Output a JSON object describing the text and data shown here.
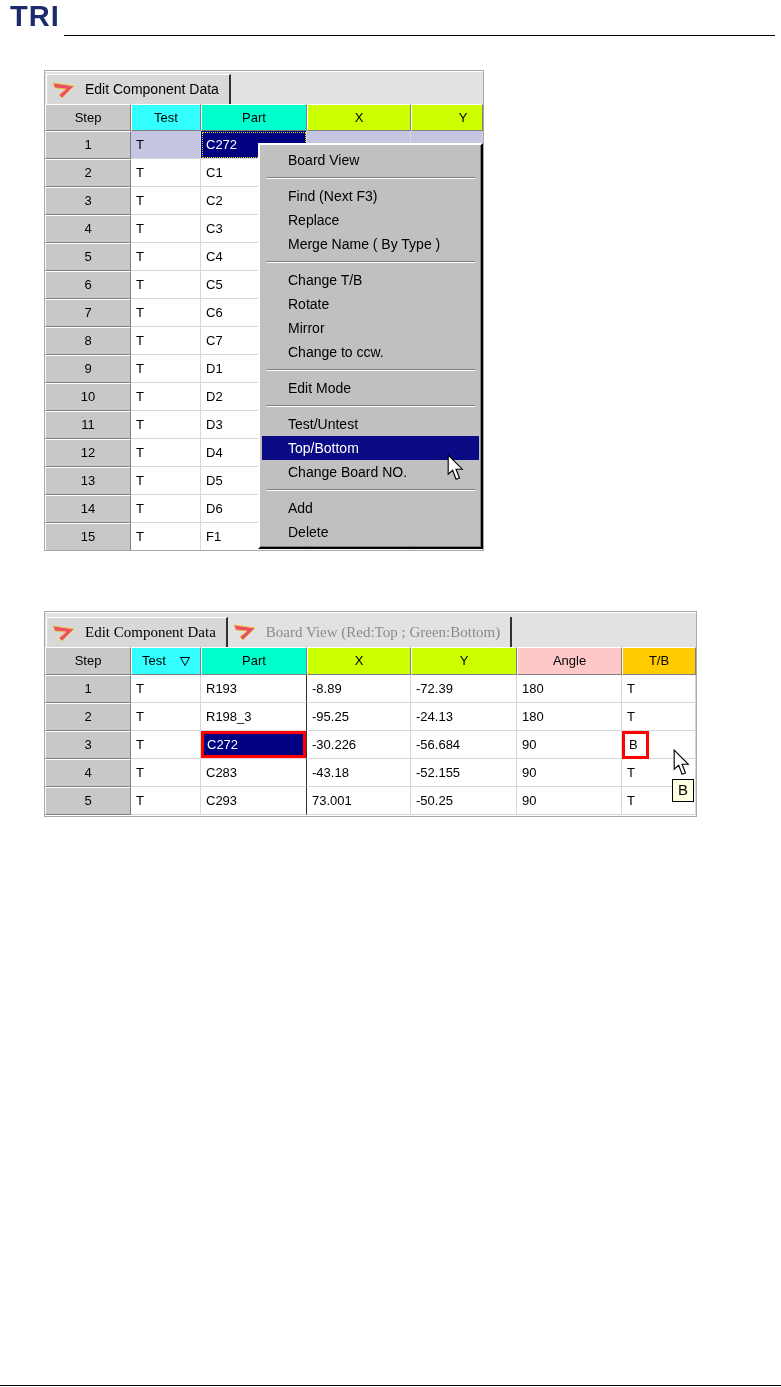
{
  "header": {
    "logo": "TRI"
  },
  "screenshots": [
    {
      "tabs": [
        {
          "label": "Edit Component Data",
          "selected": true
        }
      ],
      "table": {
        "columns": [
          {
            "label": "Step",
            "color": "#c8c8c8",
            "filtered": false
          },
          {
            "label": "Test",
            "color": "#33ffff",
            "filtered": false
          },
          {
            "label": "Part",
            "color": "#00ffcc",
            "filtered": false
          },
          {
            "label": "X",
            "color": "#ccff00",
            "filtered": false
          },
          {
            "label": "Y",
            "color": "#ccff00",
            "filtered": false
          }
        ],
        "rows": [
          {
            "step": "1",
            "selected": true,
            "cells": [
              {
                "text": "T",
                "selected": false,
                "highlighted": false
              },
              {
                "text": "C272",
                "selected": true,
                "highlighted": false
              }
            ]
          },
          {
            "step": "2",
            "selected": false,
            "cells": [
              {
                "text": "T",
                "selected": false,
                "highlighted": false
              },
              {
                "text": "C1",
                "selected": false,
                "highlighted": false
              }
            ]
          },
          {
            "step": "3",
            "selected": false,
            "cells": [
              {
                "text": "T",
                "selected": false,
                "highlighted": false
              },
              {
                "text": "C2",
                "selected": false,
                "highlighted": false
              }
            ]
          },
          {
            "step": "4",
            "selected": false,
            "cells": [
              {
                "text": "T",
                "selected": false,
                "highlighted": false
              },
              {
                "text": "C3",
                "selected": false,
                "highlighted": false
              }
            ]
          },
          {
            "step": "5",
            "selected": false,
            "cells": [
              {
                "text": "T",
                "selected": false,
                "highlighted": false
              },
              {
                "text": "C4",
                "selected": false,
                "highlighted": false
              }
            ]
          },
          {
            "step": "6",
            "selected": false,
            "cells": [
              {
                "text": "T",
                "selected": false,
                "highlighted": false
              },
              {
                "text": "C5",
                "selected": false,
                "highlighted": false
              }
            ]
          },
          {
            "step": "7",
            "selected": false,
            "cells": [
              {
                "text": "T",
                "selected": false,
                "highlighted": false
              },
              {
                "text": "C6",
                "selected": false,
                "highlighted": false
              }
            ]
          },
          {
            "step": "8",
            "selected": false,
            "cells": [
              {
                "text": "T",
                "selected": false,
                "highlighted": false
              },
              {
                "text": "C7",
                "selected": false,
                "highlighted": false
              }
            ]
          },
          {
            "step": "9",
            "selected": false,
            "cells": [
              {
                "text": "T",
                "selected": false,
                "highlighted": false
              },
              {
                "text": "D1",
                "selected": false,
                "highlighted": false
              }
            ]
          },
          {
            "step": "10",
            "selected": false,
            "cells": [
              {
                "text": "T",
                "selected": false,
                "highlighted": false
              },
              {
                "text": "D2",
                "selected": false,
                "highlighted": false
              }
            ]
          },
          {
            "step": "11",
            "selected": false,
            "cells": [
              {
                "text": "T",
                "selected": false,
                "highlighted": false
              },
              {
                "text": "D3",
                "selected": false,
                "highlighted": false
              }
            ]
          },
          {
            "step": "12",
            "selected": false,
            "cells": [
              {
                "text": "T",
                "selected": false,
                "highlighted": false
              },
              {
                "text": "D4",
                "selected": false,
                "highlighted": false
              }
            ]
          },
          {
            "step": "13",
            "selected": false,
            "cells": [
              {
                "text": "T",
                "selected": false,
                "highlighted": false
              },
              {
                "text": "D5",
                "selected": false,
                "highlighted": false
              }
            ]
          },
          {
            "step": "14",
            "selected": false,
            "cells": [
              {
                "text": "T",
                "selected": false,
                "highlighted": false
              },
              {
                "text": "D6",
                "selected": false,
                "highlighted": false
              }
            ]
          },
          {
            "step": "15",
            "selected": false,
            "cells": [
              {
                "text": "T",
                "selected": false,
                "highlighted": false
              },
              {
                "text": "F1",
                "selected": false,
                "highlighted": false
              }
            ]
          }
        ]
      },
      "context_menu": {
        "items": [
          {
            "kind": "item",
            "label": "Board View",
            "selected": false
          },
          {
            "kind": "separator"
          },
          {
            "kind": "item",
            "label": "Find (Next F3)",
            "selected": false
          },
          {
            "kind": "item",
            "label": "Replace",
            "selected": false
          },
          {
            "kind": "item",
            "label": "Merge Name ( By Type )",
            "selected": false
          },
          {
            "kind": "separator"
          },
          {
            "kind": "item",
            "label": "Change T/B",
            "selected": false
          },
          {
            "kind": "item",
            "label": "Rotate",
            "selected": false
          },
          {
            "kind": "item",
            "label": "Mirror",
            "selected": false
          },
          {
            "kind": "item",
            "label": "Change to ccw.",
            "selected": false
          },
          {
            "kind": "separator"
          },
          {
            "kind": "item",
            "label": "Edit Mode",
            "selected": false
          },
          {
            "kind": "separator"
          },
          {
            "kind": "item",
            "label": "Test/Untest",
            "selected": false
          },
          {
            "kind": "item",
            "label": "Top/Bottom",
            "selected": true
          },
          {
            "kind": "item",
            "label": "Change Board NO.",
            "selected": false
          },
          {
            "kind": "separator"
          },
          {
            "kind": "item",
            "label": "Add",
            "selected": false
          },
          {
            "kind": "item",
            "label": "Delete",
            "selected": false
          }
        ]
      }
    },
    {
      "tabs": [
        {
          "label": "Edit Component Data",
          "selected": true
        },
        {
          "label": "Board View (Red:Top ; Green:Bottom)",
          "selected": false
        }
      ],
      "table": {
        "columns": [
          {
            "label": "Step",
            "color": "#c8c8c8",
            "filtered": false
          },
          {
            "label": "Test",
            "color": "#33ffff",
            "filtered": true
          },
          {
            "label": "Part",
            "color": "#00ffcc",
            "filtered": false
          },
          {
            "label": "X",
            "color": "#ccff00",
            "filtered": false
          },
          {
            "label": "Y",
            "color": "#ccff00",
            "filtered": false
          },
          {
            "label": "Angle",
            "color": "#ffc8c8",
            "filtered": false
          },
          {
            "label": "T/B",
            "color": "#ffcc00",
            "filtered": false
          }
        ],
        "rows": [
          {
            "step": "1",
            "selected": false,
            "cells": [
              {
                "text": "T",
                "selected": false,
                "highlighted": false
              },
              {
                "text": "R193",
                "selected": false,
                "highlighted": false
              },
              {
                "text": "-8.89",
                "selected": false,
                "highlighted": false
              },
              {
                "text": "-72.39",
                "selected": false,
                "highlighted": false
              },
              {
                "text": "180",
                "selected": false,
                "highlighted": false
              },
              {
                "text": "T",
                "selected": false,
                "highlighted": false
              }
            ]
          },
          {
            "step": "2",
            "selected": false,
            "cells": [
              {
                "text": "T",
                "selected": false,
                "highlighted": false
              },
              {
                "text": "R198_3",
                "selected": false,
                "highlighted": false
              },
              {
                "text": "-95.25",
                "selected": false,
                "highlighted": false
              },
              {
                "text": "-24.13",
                "selected": false,
                "highlighted": false
              },
              {
                "text": "180",
                "selected": false,
                "highlighted": false
              },
              {
                "text": "T",
                "selected": false,
                "highlighted": false
              }
            ]
          },
          {
            "step": "3",
            "selected": false,
            "cells": [
              {
                "text": "T",
                "selected": false,
                "highlighted": false
              },
              {
                "text": "C272",
                "selected": true,
                "highlighted": true
              },
              {
                "text": "-30.226",
                "selected": false,
                "highlighted": false
              },
              {
                "text": "-56.684",
                "selected": false,
                "highlighted": false
              },
              {
                "text": "90",
                "selected": false,
                "highlighted": false
              },
              {
                "text": "B",
                "selected": false,
                "highlighted": true
              }
            ]
          },
          {
            "step": "4",
            "selected": false,
            "cells": [
              {
                "text": "T",
                "selected": false,
                "highlighted": false
              },
              {
                "text": "C283",
                "selected": false,
                "highlighted": false
              },
              {
                "text": "-43.18",
                "selected": false,
                "highlighted": false
              },
              {
                "text": "-52.155",
                "selected": false,
                "highlighted": false
              },
              {
                "text": "90",
                "selected": false,
                "highlighted": false
              },
              {
                "text": "T",
                "selected": false,
                "highlighted": false
              }
            ]
          },
          {
            "step": "5",
            "selected": false,
            "cells": [
              {
                "text": "T",
                "selected": false,
                "highlighted": false
              },
              {
                "text": "C293",
                "selected": false,
                "highlighted": false
              },
              {
                "text": "73.001",
                "selected": false,
                "highlighted": false
              },
              {
                "text": "-50.25",
                "selected": false,
                "highlighted": false
              },
              {
                "text": "90",
                "selected": false,
                "highlighted": false
              },
              {
                "text": "T",
                "selected": false,
                "highlighted": false
              }
            ]
          }
        ]
      },
      "tooltip": {
        "text": "B"
      }
    }
  ]
}
